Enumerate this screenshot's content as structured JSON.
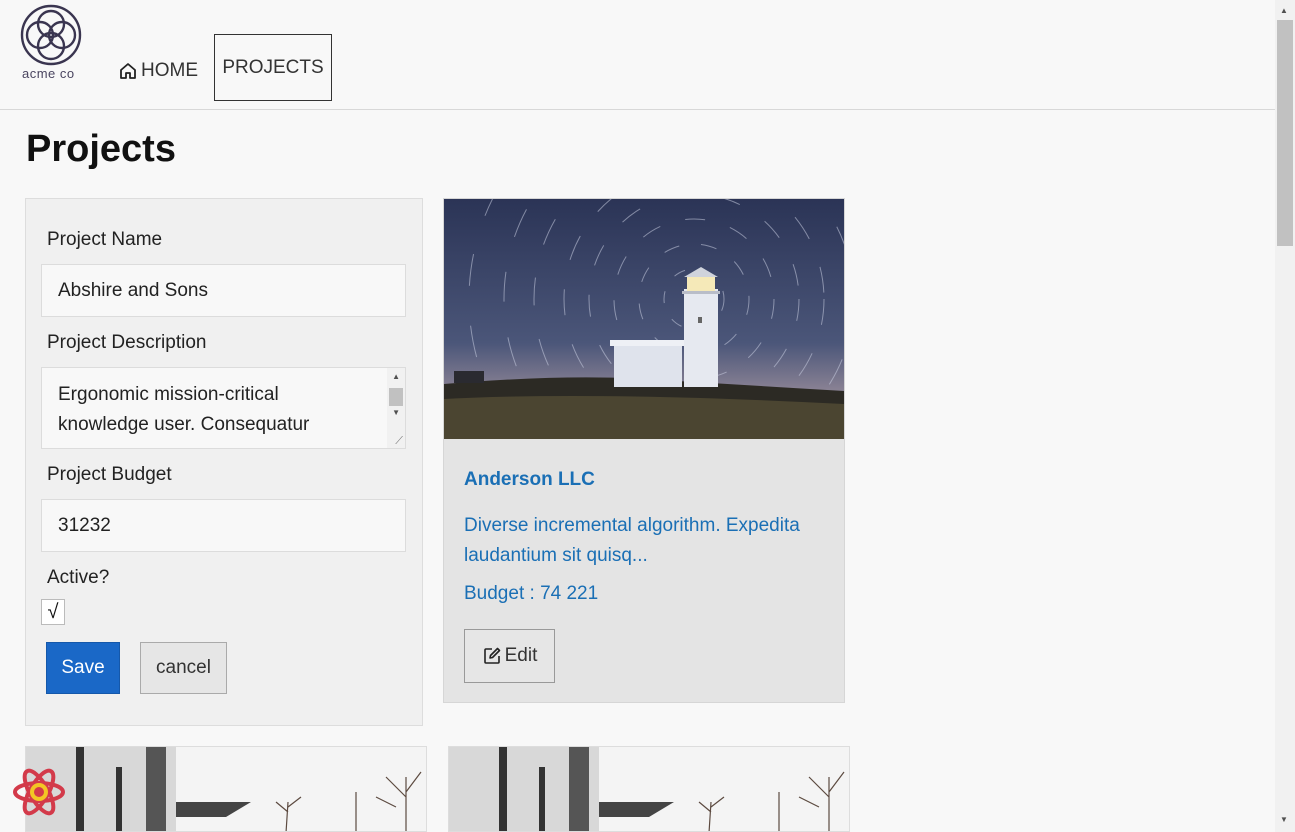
{
  "header": {
    "logo_text": "acme co",
    "nav": [
      {
        "label": "HOME",
        "icon": "home-icon",
        "active": false
      },
      {
        "label": "PROJECTS",
        "icon": "",
        "active": true
      }
    ]
  },
  "page": {
    "title": "Projects"
  },
  "form": {
    "name_label": "Project Name",
    "name_value": "Abshire and Sons",
    "description_label": "Project Description",
    "description_value": "Ergonomic mission-critical knowledge user. Consequatur",
    "budget_label": "Project Budget",
    "budget_value": "31232",
    "active_label": "Active?",
    "active_checked": true,
    "active_mark": "√",
    "save_label": "Save",
    "cancel_label": "cancel"
  },
  "projects": [
    {
      "name": "Anderson LLC",
      "description": "Diverse incremental algorithm. Expedita laudantium sit quisq...",
      "budget_label": "Budget :",
      "budget_value": "74 221",
      "edit_label": "Edit",
      "image": "lighthouse-star-trails"
    }
  ],
  "colors": {
    "accent": "#1a68c7",
    "link": "#1a6fb5",
    "card_bg": "#e4e4e4",
    "form_bg": "#f0f0f0"
  }
}
